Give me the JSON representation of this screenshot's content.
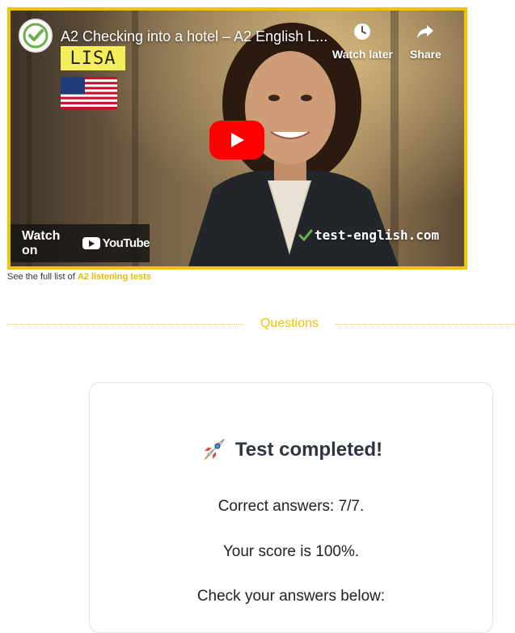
{
  "video": {
    "title": "A2 Checking into a hotel – A2 English L...",
    "watch_later_label": "Watch later",
    "share_label": "Share",
    "watch_on_label": "Watch on",
    "youtube_label": "YouTube",
    "name_tag": "LISA",
    "watermark": "test-english.com",
    "channel_logo": "test-english-logo",
    "accent_color": "#f2c500"
  },
  "caption": {
    "prefix": "See the full list of ",
    "link_label": "A2 listening tests"
  },
  "section": {
    "title": "Questions"
  },
  "result": {
    "icon": "rocket-icon",
    "title": "Test completed!",
    "correct_answers": "Correct answers: 7/7.",
    "score": "Your score is 100%.",
    "check": "Check your answers below:"
  }
}
